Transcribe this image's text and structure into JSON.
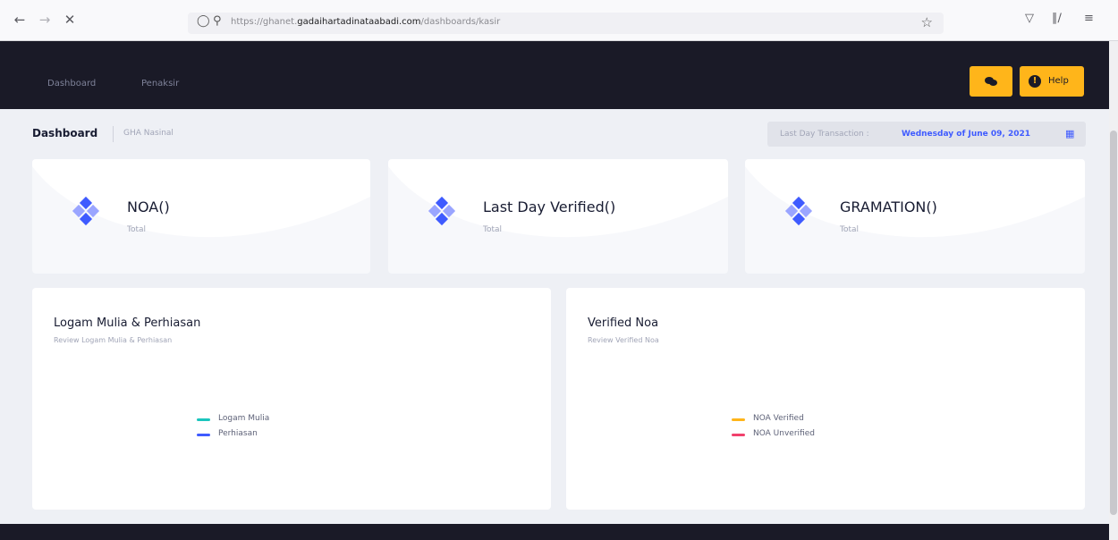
{
  "browser": {
    "url_prefix": "https://ghanet.",
    "url_domain": "gadaihartadinataabadi.com",
    "url_path": "/dashboards/kasir"
  },
  "header": {
    "nav_items": [
      "Dashboard",
      "Penaksir"
    ],
    "help_label": "Help"
  },
  "subheader": {
    "title": "Dashboard",
    "breadcrumb": "GHA Nasinal",
    "last_tx_label": "Last Day Transaction :",
    "last_tx_value": "Wednesday of June 09, 2021"
  },
  "stats": [
    {
      "title": "NOA()",
      "subtitle": "Total"
    },
    {
      "title": "Last Day Verified()",
      "subtitle": "Total"
    },
    {
      "title": "GRAMATION()",
      "subtitle": "Total"
    }
  ],
  "charts": [
    {
      "title": "Logam Mulia & Perhiasan",
      "subtitle": "Review Logam Mulia & Perhiasan",
      "legend": [
        {
          "label": "Logam Mulia",
          "color": "#1bc5bd"
        },
        {
          "label": "Perhiasan",
          "color": "#3f5bff"
        }
      ]
    },
    {
      "title": "Verified Noa",
      "subtitle": "Review Verified Noa",
      "legend": [
        {
          "label": "NOA Verified",
          "color": "#ffb51a"
        },
        {
          "label": "NOA Unverified",
          "color": "#f1416c"
        }
      ]
    }
  ],
  "colors": {
    "header_bg": "#1a1a27",
    "accent": "#ffb51a",
    "primary": "#3f5bff",
    "icon_light": "#9aa5ff"
  },
  "icons": {
    "back": "arrow-left-icon",
    "forward": "arrow-right-icon",
    "stop": "close-icon",
    "shield": "shield-icon",
    "lock": "lock-icon",
    "star": "star-icon",
    "chat": "chat-icon",
    "help": "exclamation-circle-icon",
    "calendar": "calendar-icon"
  }
}
